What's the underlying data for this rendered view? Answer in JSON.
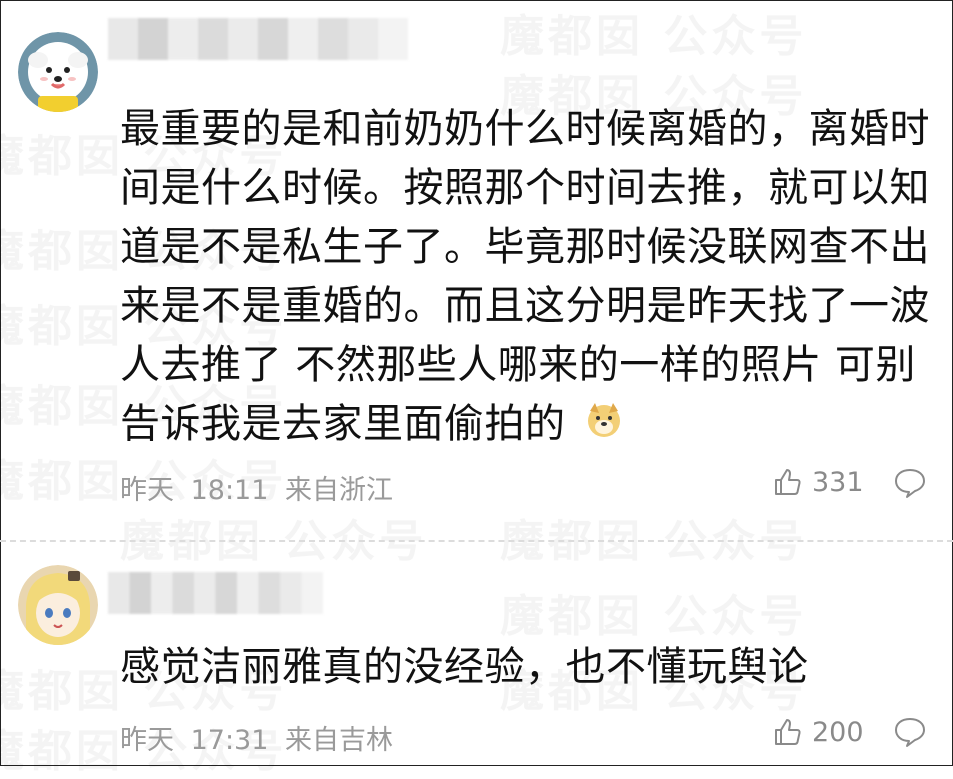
{
  "watermark": "魔都囡 公众号",
  "comments": [
    {
      "avatar": "dog-avatar",
      "text_lines": [
        "最重要的是和前奶奶什么时候离婚的，离婚时",
        "间是什么时候。按照那个时间去推，就可以知",
        "道是不是私生子了。毕竟那时候没联网查不出",
        "来是不是重婚的。而且这分明是昨天找了一波",
        "人去推了 不然那些人哪来的一样的照片 可别",
        "告诉我是去家里面偷拍的"
      ],
      "emoji": "doge-emoji",
      "date": "昨天",
      "time": "18:11",
      "location": "来自浙江",
      "likes": "331"
    },
    {
      "avatar": "anime-girl-avatar",
      "text_lines": [
        "感觉洁丽雅真的没经验，也不懂玩舆论"
      ],
      "date": "昨天",
      "time": "17:31",
      "location": "来自吉林",
      "likes": "200"
    }
  ]
}
